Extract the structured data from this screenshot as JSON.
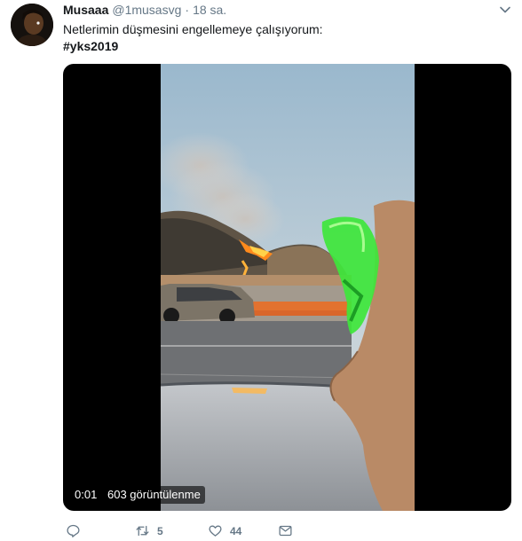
{
  "tweet": {
    "author_name": "Musaaa",
    "handle": "@1musasvg",
    "separator": "·",
    "time": "18 sa.",
    "text_line1": "Netlerimin düşmesini engellemeye çalışıyorum:",
    "hashtag": "#yks2019"
  },
  "video": {
    "duration": "0:01",
    "views": "603 görüntülenme"
  },
  "actions": {
    "reply_count": "",
    "retweet_count": "5",
    "like_count": "44"
  },
  "colors": {
    "text": "#14171a",
    "muted": "#657786",
    "video_bg": "#000000"
  },
  "icons": [
    "avatar",
    "chevron-down-icon",
    "reply-icon",
    "retweet-icon",
    "heart-icon",
    "message-icon"
  ]
}
